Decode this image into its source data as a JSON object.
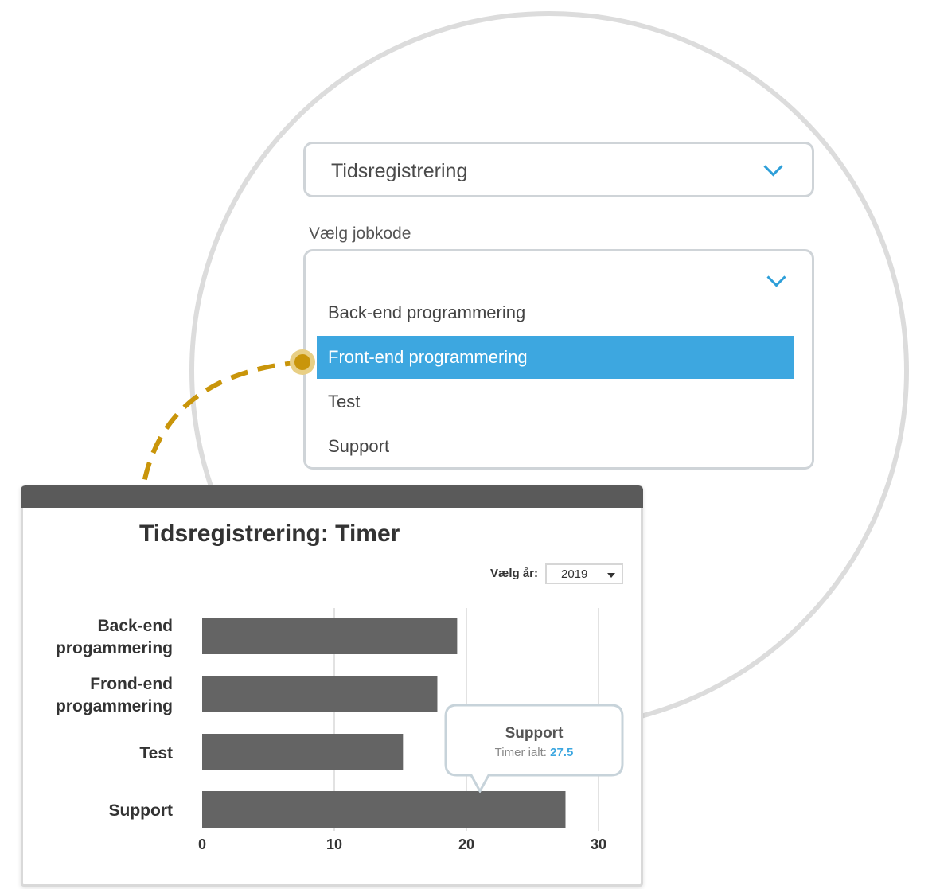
{
  "main_select": {
    "value": "Tidsregistrering"
  },
  "jobcode": {
    "label": "Vælg jobkode",
    "options": [
      "Back-end programmering",
      "Front-end programmering",
      "Test",
      "Support"
    ],
    "selected": "Front-end programmering"
  },
  "report": {
    "title": "Tidsregistrering: Timer",
    "year_label": "Vælg år:",
    "year_value": "2019"
  },
  "tooltip": {
    "title": "Support",
    "label": "Timer ialt:",
    "value": "27.5"
  },
  "colors": {
    "accent": "#3da7e0",
    "bar": "#646464",
    "connector": "#c9950a",
    "header": "#5a5a5a"
  },
  "chart_data": {
    "type": "bar",
    "orientation": "horizontal",
    "categories": [
      [
        "Back-end",
        "progammering"
      ],
      [
        "Frond-end",
        "progammering"
      ],
      [
        "Test"
      ],
      [
        "Support"
      ]
    ],
    "values": [
      19.3,
      17.8,
      15.2,
      27.5
    ],
    "xticks": [
      0,
      10,
      20,
      30
    ],
    "xlim": [
      0,
      33
    ],
    "grid": true
  }
}
